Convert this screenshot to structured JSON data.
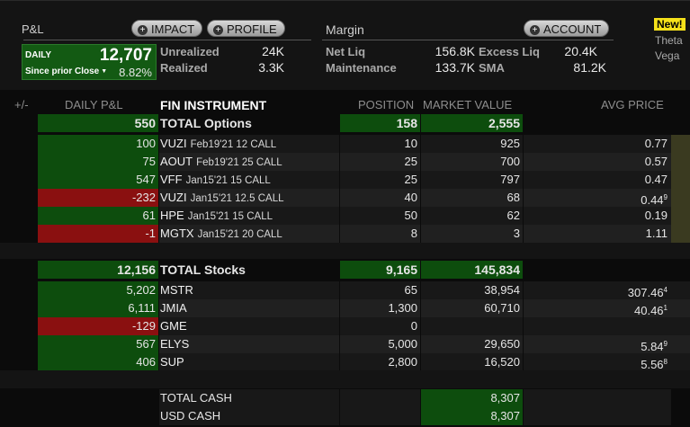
{
  "pl": {
    "label": "P&L",
    "impact_btn": "IMPACT",
    "profile_btn": "PROFILE",
    "daily_label": "DAILY",
    "daily_value": "12,707",
    "since_label": "Since prior Close",
    "daily_pct": "8.82%",
    "unrealized_label": "Unrealized",
    "unrealized_value": "24K",
    "realized_label": "Realized",
    "realized_value": "3.3K"
  },
  "margin": {
    "label": "Margin",
    "account_btn": "ACCOUNT",
    "netliq_label": "Net Liq",
    "netliq_value": "156.8K",
    "excess_label": "Excess Liq",
    "excess_value": "20.4K",
    "maint_label": "Maintenance",
    "maint_value": "133.7K",
    "sma_label": "SMA",
    "sma_value": "81.2K"
  },
  "greeks": {
    "new_tag": "New!",
    "theta": "Theta",
    "vega": "Vega"
  },
  "columns": {
    "plusminus": "+/-",
    "daily_pnl": "DAILY P&L",
    "instrument": "FIN INSTRUMENT",
    "position": "POSITION",
    "market_value": "MARKET VALUE",
    "avg_price": "AVG PRICE"
  },
  "options_total": {
    "pnl": "550",
    "name": "TOTAL Options",
    "position": "158",
    "market_value": "2,555"
  },
  "options": [
    {
      "pnl": "100",
      "sym": "VUZI",
      "desc": "Feb19'21 12 CALL",
      "position": "10",
      "market_value": "925",
      "avg": "0.77",
      "avg_sup": "",
      "neg": false
    },
    {
      "pnl": "75",
      "sym": "AOUT",
      "desc": "Feb19'21 25 CALL",
      "position": "25",
      "market_value": "700",
      "avg": "0.57",
      "avg_sup": "",
      "neg": false
    },
    {
      "pnl": "547",
      "sym": "VFF",
      "desc": "Jan15'21 15 CALL",
      "position": "25",
      "market_value": "797",
      "avg": "0.47",
      "avg_sup": "",
      "neg": false
    },
    {
      "pnl": "-232",
      "sym": "VUZI",
      "desc": "Jan15'21 12.5 CALL",
      "position": "40",
      "market_value": "68",
      "avg": "0.44",
      "avg_sup": "9",
      "neg": true
    },
    {
      "pnl": "61",
      "sym": "HPE",
      "desc": "Jan15'21 15 CALL",
      "position": "50",
      "market_value": "62",
      "avg": "0.19",
      "avg_sup": "",
      "neg": false
    },
    {
      "pnl": "-1",
      "sym": "MGTX",
      "desc": "Jan15'21 20 CALL",
      "position": "8",
      "market_value": "3",
      "avg": "1.11",
      "avg_sup": "",
      "neg": true
    }
  ],
  "stocks_total": {
    "pnl": "12,156",
    "name": "TOTAL Stocks",
    "position": "9,165",
    "market_value": "145,834"
  },
  "stocks": [
    {
      "pnl": "5,202",
      "sym": "MSTR",
      "position": "65",
      "market_value": "38,954",
      "avg": "307.46",
      "avg_sup": "4",
      "neg": false
    },
    {
      "pnl": "6,111",
      "sym": "JMIA",
      "position": "1,300",
      "market_value": "60,710",
      "avg": "40.46",
      "avg_sup": "1",
      "neg": false
    },
    {
      "pnl": "-129",
      "sym": "GME",
      "position": "0",
      "market_value": "",
      "avg": "",
      "avg_sup": "",
      "neg": true
    },
    {
      "pnl": "567",
      "sym": "ELYS",
      "position": "5,000",
      "market_value": "29,650",
      "avg": "5.84",
      "avg_sup": "9",
      "neg": false
    },
    {
      "pnl": "406",
      "sym": "SUP",
      "position": "2,800",
      "market_value": "16,520",
      "avg": "5.56",
      "avg_sup": "8",
      "neg": false
    }
  ],
  "cash": [
    {
      "label": "TOTAL CASH",
      "value": "8,307"
    },
    {
      "label": "USD CASH",
      "value": "8,307"
    }
  ]
}
